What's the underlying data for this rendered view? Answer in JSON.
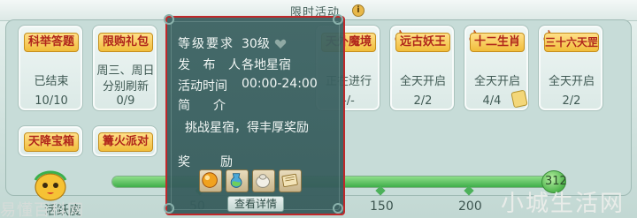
{
  "header": {
    "title": "限时活动",
    "info_icon": "info-icon",
    "info_glyph": "i"
  },
  "cards": [
    {
      "name": "科举答题",
      "status": "已结束",
      "count": "10/10",
      "hot": false
    },
    {
      "name": "限购礼包",
      "status": "周三、周日",
      "status_line2": "分别刷新",
      "count": "0/9",
      "hot": false
    },
    {
      "name": "天外魔境",
      "status": "正在进行",
      "count": "-/-",
      "hot": false
    },
    {
      "name": "远古妖王",
      "status": "全天开启",
      "count": "2/2",
      "hot": true
    },
    {
      "name": "十二生肖",
      "status": "全天开启",
      "count": "4/4",
      "hot": true
    },
    {
      "name": "三十六天罡",
      "status": "全天开启",
      "count": "2/2",
      "hot": true
    }
  ],
  "cards_row2": [
    {
      "name": "天降宝箱"
    },
    {
      "name": "篝火派对"
    }
  ],
  "activity": {
    "label": "活跃度",
    "current": "312",
    "max": 312,
    "progress_fraction": 1.0,
    "ticks": [
      "50",
      "150",
      "200"
    ]
  },
  "tooltip": {
    "level_label": "等级要求",
    "level_value": "30级",
    "publisher_label": "发 布 人",
    "publisher_value": "各地星宿",
    "time_label": "活动时间",
    "time_value": "00:00-24:00",
    "intro_label": "简　介",
    "description": "挑战星宿，得丰厚奖励",
    "reward_label": "奖　　励",
    "rewards": [
      "orb-icon",
      "potion-icon",
      "scroll-bundle-icon",
      "book-icon"
    ],
    "details_button": "查看详情"
  },
  "watermarks": {
    "left": "易懂百科网",
    "right": "小城生活网"
  },
  "colors": {
    "tooltip_border": "#c0282a",
    "progress": "#3fae4a",
    "name_tag": "#f1bd3a"
  }
}
